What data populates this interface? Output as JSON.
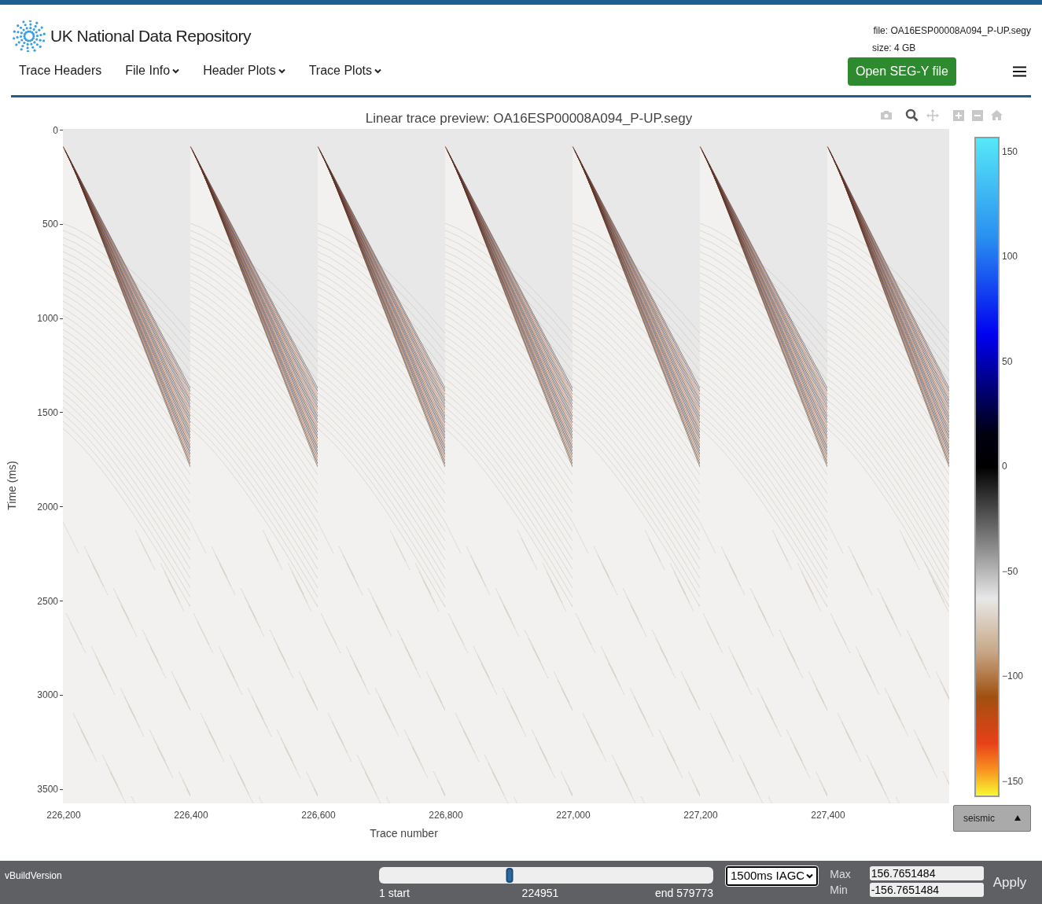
{
  "header": {
    "brand": "UK National Data Repository",
    "file": "file: OA16ESP00008A094_P-UP.segy",
    "size": "size: 4 GB",
    "open_button": "Open SEG-Y file"
  },
  "nav": [
    {
      "label": "Trace Headers",
      "dropdown": false
    },
    {
      "label": "File Info",
      "dropdown": true
    },
    {
      "label": "Header Plots",
      "dropdown": true
    },
    {
      "label": "Trace Plots",
      "dropdown": true
    }
  ],
  "plot": {
    "title": "Linear trace preview: OA16ESP00008A094_P-UP.segy",
    "ylabel": "Time (ms)",
    "xlabel": "Trace number",
    "yticks": [
      "0",
      "500",
      "1000",
      "1500",
      "2000",
      "2500",
      "3000",
      "3500"
    ],
    "xticks": [
      "226,200",
      "226,400",
      "226,600",
      "226,800",
      "227,000",
      "227,200",
      "227,400"
    ],
    "colorbar_ticks": [
      "150",
      "100",
      "50",
      "0",
      "−50",
      "−100",
      "−150"
    ],
    "colormap": "seismic"
  },
  "footer": {
    "build": "vBuildVersion",
    "slider": {
      "level": 0.39,
      "start": "1 start",
      "value": "224951",
      "end": "end 579773"
    },
    "gain": "1500ms IAGC",
    "max_label": "Max",
    "max_value": "156.7651484",
    "min_label": "Min",
    "min_value": "-156.7651484",
    "apply": "Apply"
  }
}
